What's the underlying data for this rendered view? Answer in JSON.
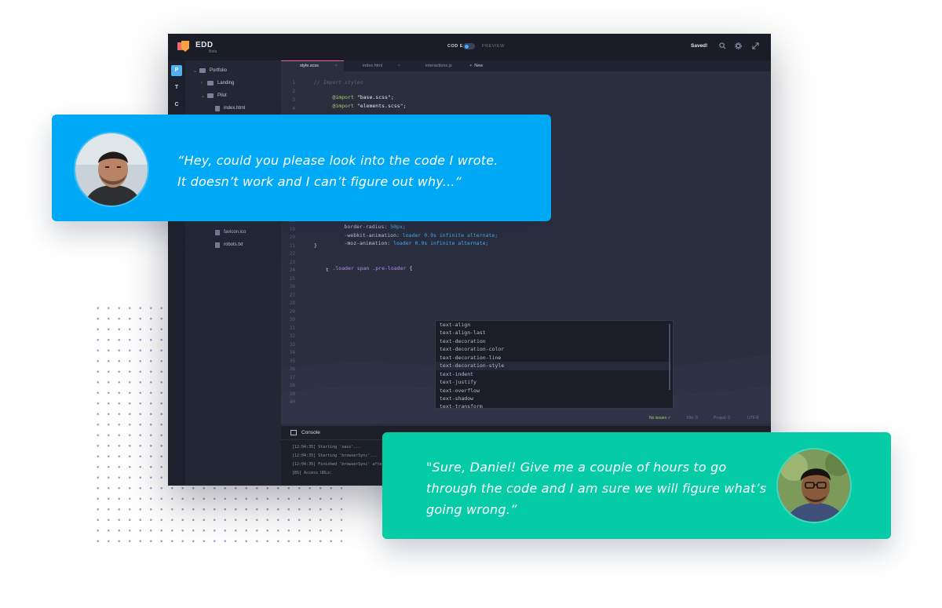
{
  "editor": {
    "app_name": "EDD",
    "app_subtitle": "Beta",
    "mode_code_label": "COD E",
    "mode_preview_label": "PREVIEW",
    "save_status": "Saved!",
    "icons": [
      "search-icon",
      "gear-icon",
      "expand-icon"
    ],
    "iconbar": [
      "P",
      "T",
      "C"
    ],
    "sidebar": {
      "items": [
        {
          "label": "Portfolio",
          "type": "folder"
        },
        {
          "label": "Landing",
          "type": "folder"
        },
        {
          "label": "Pilot",
          "type": "folder"
        },
        {
          "label": "index.html",
          "type": "file"
        },
        {
          "label": "favicon.ico",
          "type": "file"
        },
        {
          "label": "robots.txt",
          "type": "file"
        }
      ]
    },
    "tabs": [
      {
        "label": "style.scss",
        "active": true
      },
      {
        "label": "index.html",
        "active": false
      },
      {
        "label": "interactions.js",
        "active": false
      }
    ],
    "new_tab_label": "New",
    "code": {
      "comment": "// Import styles",
      "import_kw": "@import",
      "import1": "\"base.scss\";",
      "import2": "\"elements.scss\";",
      "l18_prop": "border-radius:",
      "l18_val": "50px;",
      "l19_prop": "-webkit-animation:",
      "l19_val": "loader 0.9s infinite alternate;",
      "l20_prop": "-moz-animation:",
      "l20_val": "loader 0.9s infinite alternate;",
      "l21": "}",
      "l23_sel": ".loader span .pre-loader",
      "l23_brace": "{",
      "l24": "t"
    },
    "line_numbers_top": [
      "1",
      "2",
      "3",
      "4"
    ],
    "line_numbers_bottom": [
      "18",
      "19",
      "20",
      "21",
      "22",
      "23",
      "24",
      "25",
      "26",
      "27",
      "28",
      "29",
      "30",
      "31",
      "32",
      "33",
      "34",
      "35",
      "36",
      "37",
      "38",
      "39",
      "40"
    ],
    "autocomplete": [
      "text-align",
      "text-align-last",
      "text-decoration",
      "text-decoration-color",
      "text-decoration-line",
      "text-decoration-style",
      "text-indent",
      "text-justify",
      "text-overflow",
      "text-shadow",
      "text-transform"
    ],
    "status": {
      "issues": "No issues ✓",
      "file": "File: 0",
      "project": "Project: 0",
      "encoding": "UTF-8"
    },
    "console": {
      "title": "Console",
      "lines": [
        "[12:04:35] Starting 'sass'...",
        "[12:04:35] Starting 'browserSync'...",
        "[12:04:35] Finished 'browserSync' after",
        "[BS] Access URLs:"
      ]
    }
  },
  "chat": {
    "message1": "“Hey, could you please look into the code I wrote. It doesn’t work and I can’t figure out why...“",
    "message2": "\"Sure, Daniel! Give me a couple of hours to go through the code and I am sure we will figure what’s going wrong.”",
    "colors": {
      "blue": "#00a9f5",
      "green": "#05cba6"
    }
  }
}
